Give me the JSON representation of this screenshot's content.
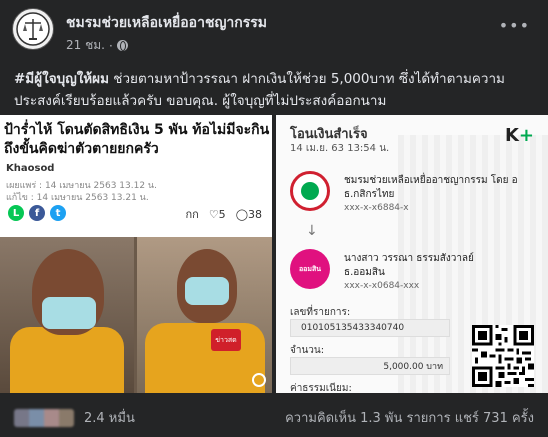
{
  "header": {
    "page_name": "ชมรมช่วยเหลือเหยื่ออาชญากรรม",
    "time": "21 ชม.",
    "separator": "·"
  },
  "caption": {
    "hashtag": "#มีผู้ใจบุญให้ผม",
    "text": " ช่วยตามหาป้าวรรณา ฝากเงินให้ช่วย 5,000บาท ซึ่งได้ทำตามความประสงค์เรียบร้อยแล้วครับ ขอบคุณ. ผู้ใจบุญที่ไม่ประสงค์ออกนาม"
  },
  "news_card": {
    "title": "ป้าร่ำไห้ โดนตัดสิทธิเงิน 5 พัน ท้อไม่มีจะกิน ถึงขั้นคิดฆ่าตัวตายยกครัว",
    "source": "Khaosod",
    "published": "เผยแพร่ : 14 เมษายน 2563 13.12 น.",
    "updated": "แก้ไข : 14 เมษายน 2563 13.21 น.",
    "social": [
      "L",
      "f",
      "t"
    ],
    "stats": [
      "กก",
      "♡5",
      "◯38"
    ],
    "mic_label": "ข่าวสด"
  },
  "slip": {
    "title": "โอนเงินสำเร็จ",
    "date": "14 เม.ย. 63   13:54 น.",
    "logo_k": "K",
    "logo_plus": "+",
    "sender_name": "ชมรมช่วยเหลือเหยื่ออาชญากรรม โดย อ",
    "sender_bank": "ธ.กสิกรไทย",
    "sender_account": "xxx-x-x6884-x",
    "receiver_name": "นางสาว วรรณา ธรรมสังวาลย์",
    "receiver_bank": "ธ.ออมสิน",
    "receiver_account": "xxx-x-x0684-xxx",
    "badge_gsb": "ออมสิน",
    "ref_label": "เลขที่รายการ:",
    "ref_value": "010105135433340740",
    "amount_label": "จำนวน:",
    "amount_value": "5,000.00 บาท",
    "fee_label": "ค่าธรรมเนียม:"
  },
  "footer": {
    "reaction_count": "2.4 หมื่น",
    "stats": "ความคิดเห็น 1.3 พัน รายการ  แชร์ 731 ครั้ง"
  }
}
